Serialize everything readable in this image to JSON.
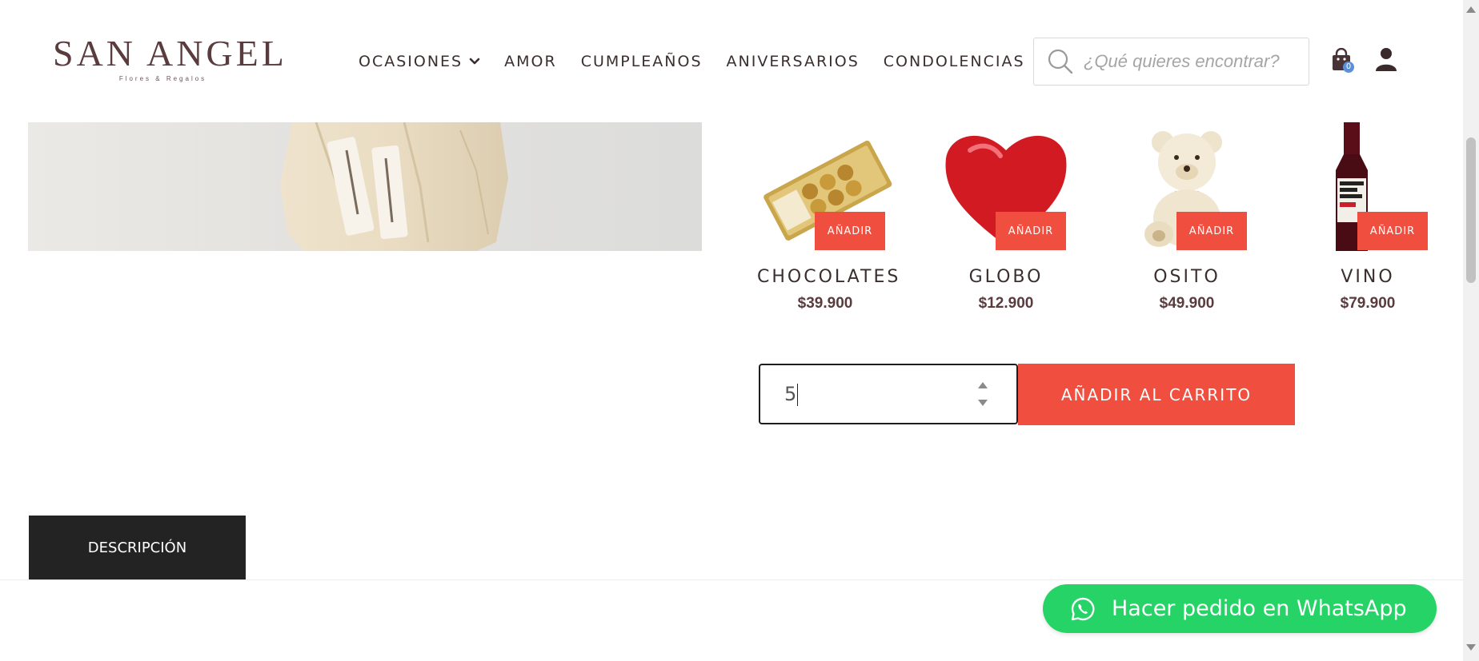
{
  "brand": {
    "name": "SAN ANGEL",
    "tagline": "Flores & Regalos"
  },
  "nav": {
    "items": [
      {
        "label": "OCASIONES",
        "has_dropdown": true
      },
      {
        "label": "AMOR"
      },
      {
        "label": "CUMPLEAÑOS"
      },
      {
        "label": "ANIVERSARIOS"
      },
      {
        "label": "CONDOLENCIAS"
      }
    ]
  },
  "search": {
    "placeholder": "¿Qué quieres encontrar?"
  },
  "cart": {
    "count": "0"
  },
  "addons": [
    {
      "name": "CHOCOLATES",
      "price": "$39.900",
      "button": "AÑADIR",
      "icon": "chocolate-box-icon"
    },
    {
      "name": "GLOBO",
      "price": "$12.900",
      "button": "AÑADIR",
      "icon": "heart-balloon-icon"
    },
    {
      "name": "OSITO",
      "price": "$49.900",
      "button": "AÑADIR",
      "icon": "teddy-bear-icon"
    },
    {
      "name": "VINO",
      "price": "$79.900",
      "button": "AÑADIR",
      "icon": "wine-bottle-icon"
    }
  ],
  "purchase": {
    "quantity": "5",
    "add_to_cart": "AÑADIR AL CARRITO"
  },
  "tabs": {
    "description": "DESCRIPCIÓN"
  },
  "whatsapp": {
    "label": "Hacer pedido en WhatsApp"
  },
  "colors": {
    "accent": "#f04e3f",
    "brand": "#5a3b3e",
    "whatsapp": "#25d366",
    "tab_bg": "#232323"
  }
}
